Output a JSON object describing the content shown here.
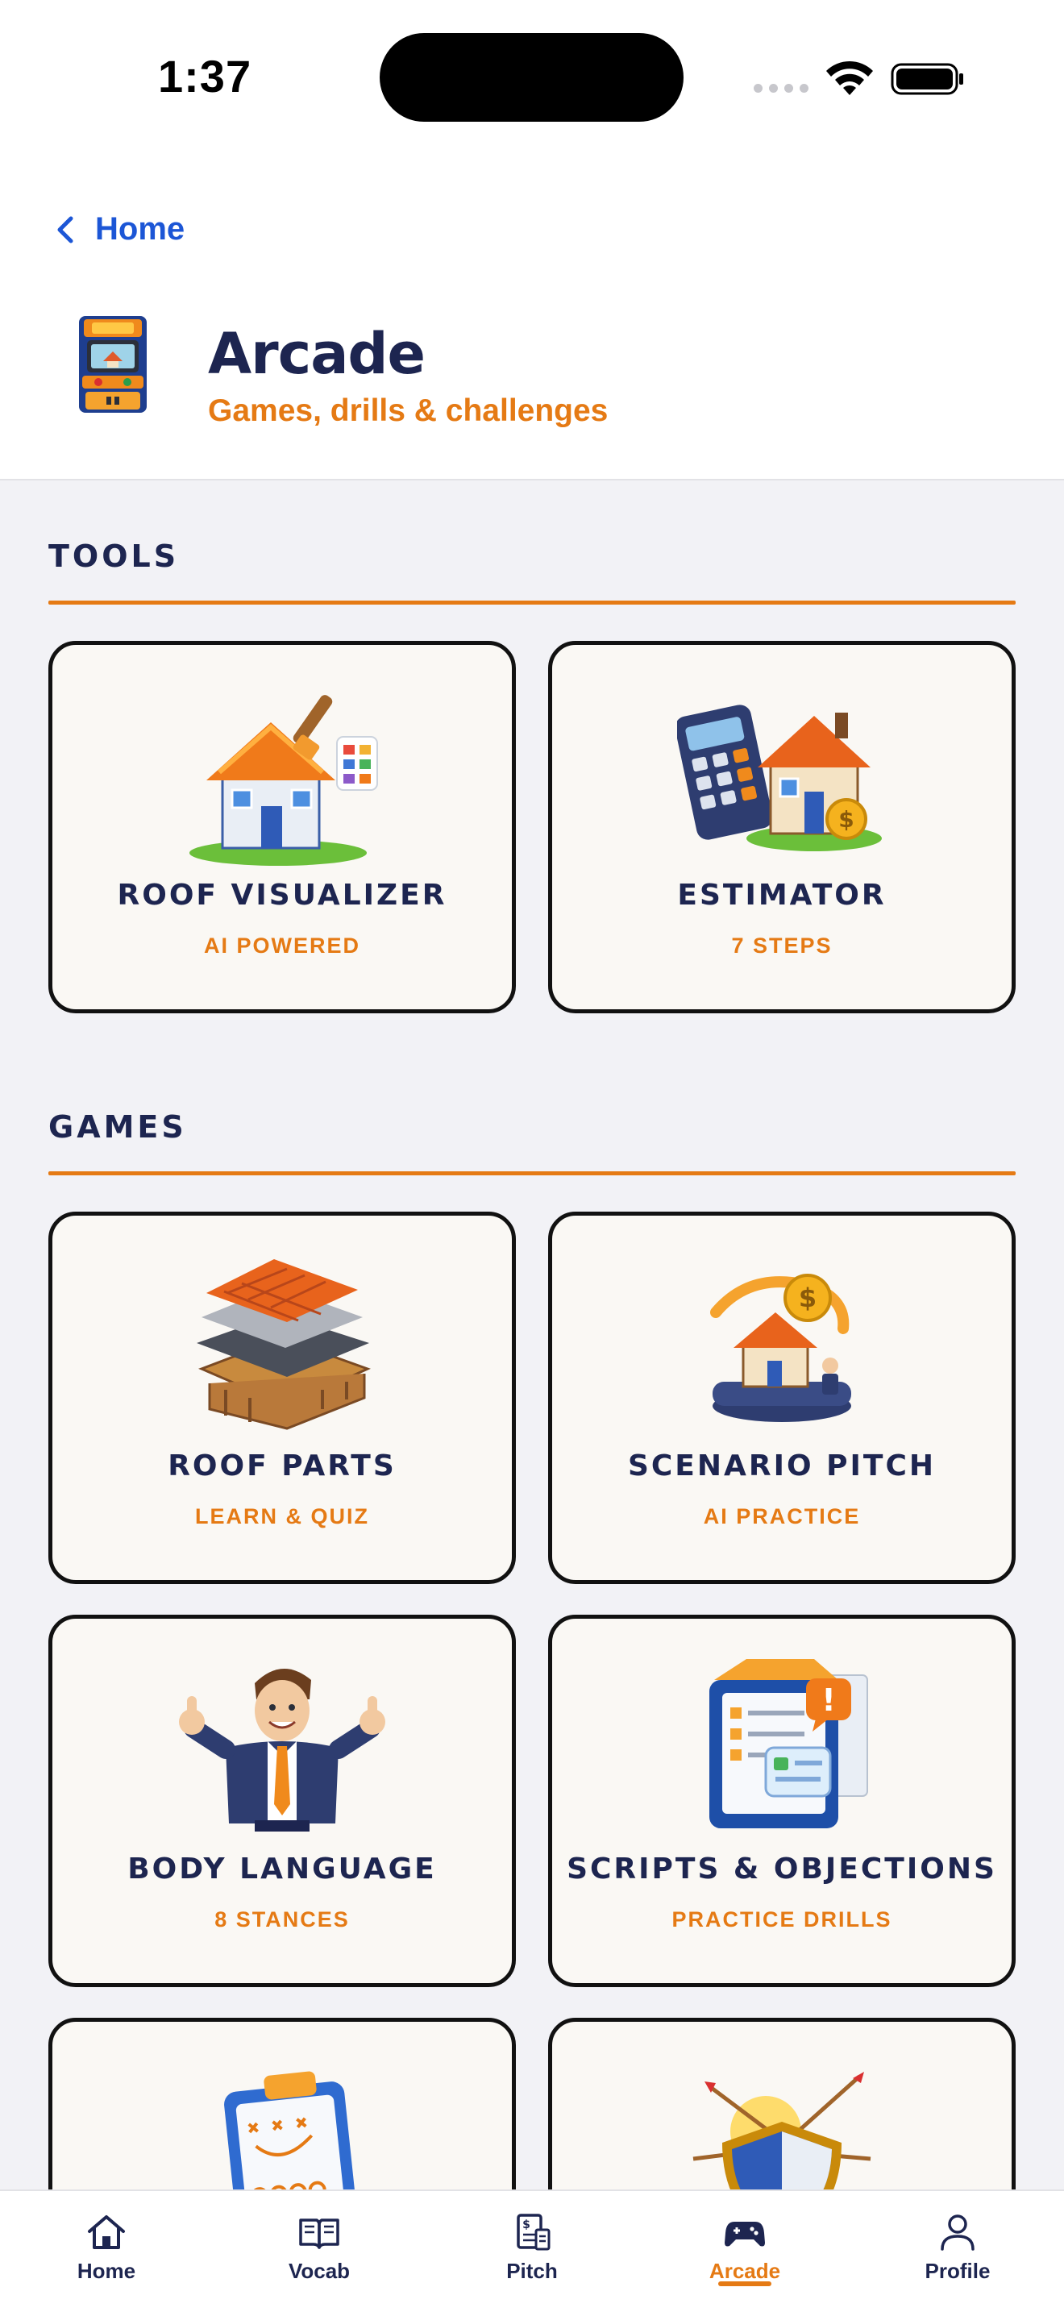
{
  "status_bar": {
    "time": "1:37"
  },
  "header": {
    "back_label": "Home",
    "title": "Arcade",
    "subtitle": "Games, drills & challenges"
  },
  "sections": [
    {
      "label": "TOOLS",
      "cards": [
        {
          "title": "ROOF VISUALIZER",
          "subtitle": "AI POWERED",
          "icon": "house-paintbrush-icon"
        },
        {
          "title": "ESTIMATOR",
          "subtitle": "7 STEPS",
          "icon": "calculator-house-icon"
        }
      ]
    },
    {
      "label": "GAMES",
      "cards": [
        {
          "title": "ROOF PARTS",
          "subtitle": "LEARN & QUIZ",
          "icon": "roof-layers-icon"
        },
        {
          "title": "SCENARIO PITCH",
          "subtitle": "AI PRACTICE",
          "icon": "house-model-icon"
        },
        {
          "title": "BODY LANGUAGE",
          "subtitle": "8 STANCES",
          "icon": "salesman-thumbs-up-icon"
        },
        {
          "title": "SCRIPTS & OBJECTIONS",
          "subtitle": "PRACTICE DRILLS",
          "icon": "script-folder-icon"
        },
        {
          "title": "",
          "subtitle": "",
          "icon": "playbook-clipboard-icon"
        },
        {
          "title": "",
          "subtitle": "",
          "icon": "shield-arrows-icon"
        }
      ]
    }
  ],
  "tab_bar": {
    "active": "Arcade",
    "tabs": [
      {
        "label": "Home",
        "icon": "home-icon"
      },
      {
        "label": "Vocab",
        "icon": "book-icon"
      },
      {
        "label": "Pitch",
        "icon": "pitch-document-icon"
      },
      {
        "label": "Arcade",
        "icon": "gamepad-icon"
      },
      {
        "label": "Profile",
        "icon": "person-icon"
      }
    ]
  },
  "colors": {
    "accent": "#E57A14",
    "navy": "#1D2550",
    "link": "#1C56D6",
    "card_bg": "#FAF8F4"
  }
}
